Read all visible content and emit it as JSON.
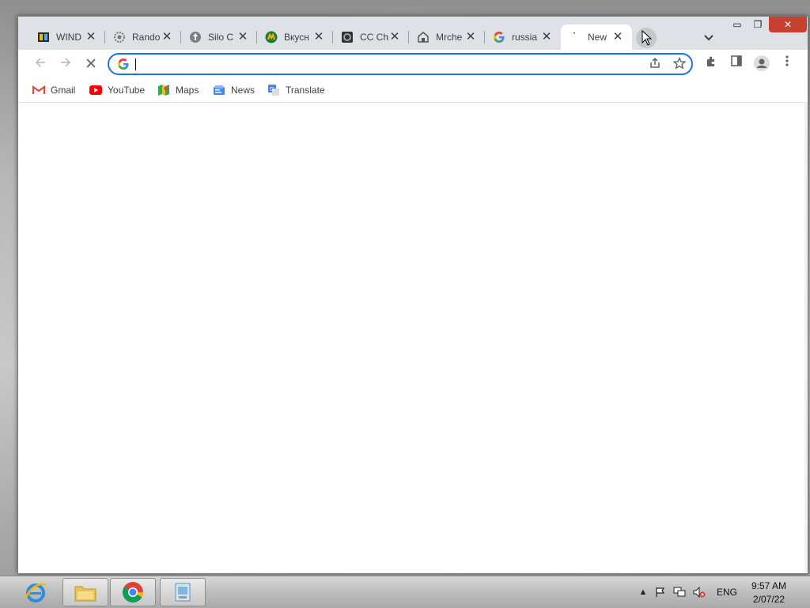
{
  "tabs": [
    {
      "title": "WIND",
      "icon": "game-icon"
    },
    {
      "title": "Rando",
      "icon": "gear-icon"
    },
    {
      "title": "Silo C",
      "icon": "silo-icon"
    },
    {
      "title": "Вкусн",
      "icon": "vkusno-icon"
    },
    {
      "title": "CC Ch",
      "icon": "chip-icon"
    },
    {
      "title": "Mrche",
      "icon": "building-icon"
    },
    {
      "title": "russia",
      "icon": "google-icon"
    },
    {
      "title": "New",
      "icon": "loading-icon",
      "active": true
    }
  ],
  "window_controls": {
    "minimize": "▭",
    "maximize": "❐",
    "close": "✕"
  },
  "omnibox": {
    "value": "",
    "placeholder": ""
  },
  "bookmarks": [
    {
      "label": "Gmail",
      "icon": "gmail-icon"
    },
    {
      "label": "YouTube",
      "icon": "youtube-icon"
    },
    {
      "label": "Maps",
      "icon": "maps-icon"
    },
    {
      "label": "News",
      "icon": "news-icon"
    },
    {
      "label": "Translate",
      "icon": "translate-icon"
    }
  ],
  "tray": {
    "language": "ENG",
    "time": "9:57 AM",
    "date": "2/07/22"
  },
  "colors": {
    "accent": "#1a73e8",
    "tabstrip": "#dee1e6",
    "close_red": "#c7402f"
  }
}
